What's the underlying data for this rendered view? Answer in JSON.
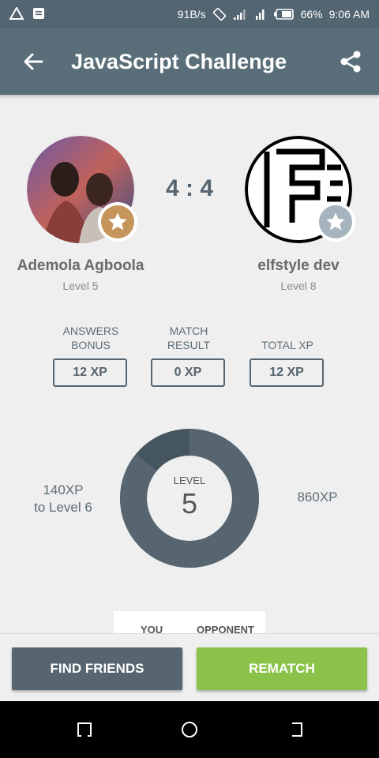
{
  "status_bar": {
    "speed": "91B/s",
    "battery": "66%",
    "time": "9:06 AM"
  },
  "app_bar": {
    "title": "JavaScript Challenge",
    "back_icon": "arrow-left-icon",
    "share_icon": "share-icon"
  },
  "players": {
    "left": {
      "name": "Ademola Agboola",
      "level": "Level 5",
      "badge_color": "#c6955c"
    },
    "right": {
      "name": "elfstyle dev",
      "level": "Level 8",
      "badge_color": "#a6b4bd"
    }
  },
  "score": "4 : 4",
  "stats": [
    {
      "label": "ANSWERS BONUS",
      "value": "12 XP"
    },
    {
      "label": "MATCH RESULT",
      "value": "0 XP"
    },
    {
      "label": "TOTAL XP",
      "value": "12 XP"
    }
  ],
  "level_ring": {
    "label": "LEVEL",
    "level": "5",
    "progress_fraction": 0.86,
    "color_done": "#56656f",
    "color_remaining": "#455660"
  },
  "xp_to_next": {
    "line1": "140XP",
    "line2": "to Level 6"
  },
  "xp_current": "860XP",
  "compare": {
    "you": "YOU",
    "opponent": "OPPONENT"
  },
  "actions": {
    "find_friends": "FIND FRIENDS",
    "rematch": "REMATCH"
  },
  "colors": {
    "primary": "#56656f",
    "accent": "#8bc34a"
  }
}
